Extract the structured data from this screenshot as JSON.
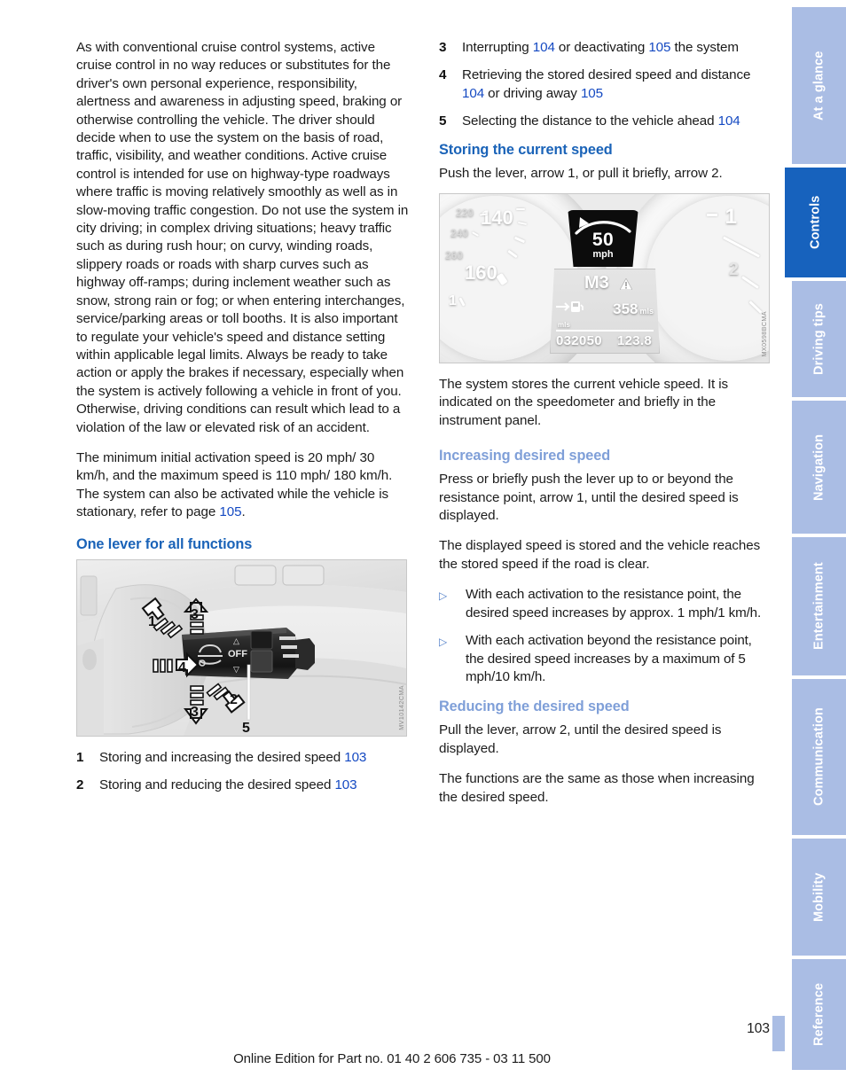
{
  "document": {
    "page_number": "103",
    "footer": "Online Edition for Part no. 01 40 2 606 735 - 03 11 500"
  },
  "left_column": {
    "paragraph_1": "As with conventional cruise control systems, active cruise control in no way reduces or substitutes for the driver's own personal experience, responsibility, alertness and awareness in adjusting speed, braking or otherwise controlling the vehicle. The driver should decide when to use the system on the basis of road, traffic, visibility, and weather conditions. Active cruise control is intended for use on highway-type roadways where traffic is moving relatively smoothly as well as in slow-moving traffic congestion. Do not use the system in city driving; in complex driving situations; heavy traffic such as during rush hour; on curvy, winding roads, slippery roads or roads with sharp curves such as highway off-ramps; during inclement weather such as snow, strong rain or fog; or when entering interchanges, service/parking areas or toll booths. It is also important to regulate your vehicle's speed and distance setting within applicable legal limits. Always be ready to take action or apply the brakes if necessary, especially when the system is actively following a vehicle in front of you. Otherwise, driving conditions can result which lead to a violation of the law or elevated risk of an accident.",
    "paragraph_2_part_1": "The minimum initial activation speed is 20 mph/ 30 km/h, and the maximum speed is 110 mph/ 180 km/h. The system can also be activated while the vehicle is stationary, refer to page ",
    "paragraph_2_link": "105",
    "paragraph_2_part_2": ".",
    "heading": "One lever for all functions",
    "figure": {
      "code": "MV10142CMA",
      "callouts": [
        "1",
        "2",
        "3",
        "3",
        "4",
        "5"
      ],
      "switch_labels": {
        "up": "△",
        "off": "OFF",
        "down": "▽"
      }
    },
    "list": [
      {
        "num": "1",
        "text_before": "Storing and increasing the desired speed ",
        "link": "103",
        "text_after": ""
      },
      {
        "num": "2",
        "text_before": "Storing and reducing the desired speed ",
        "link": "103",
        "text_after": ""
      }
    ]
  },
  "right_column": {
    "list": [
      {
        "num": "3",
        "t1": "Interrupting ",
        "l1": "104",
        "t2": " or deactivating ",
        "l2": "105",
        "t3": " the system"
      },
      {
        "num": "4",
        "t1": "Retrieving the stored desired speed and distance ",
        "l1": "104",
        "t2": " or driving away ",
        "l2": "105",
        "t3": ""
      },
      {
        "num": "5",
        "t1": "Selecting the distance to the vehicle ahead ",
        "l1": "104",
        "t2": "",
        "l2": "",
        "t3": ""
      }
    ],
    "heading_storing": "Storing the current speed",
    "paragraph_storing": "Push the lever, arrow 1, or pull it briefly, arrow 2.",
    "figure": {
      "code": "MX0598BCMA",
      "speed_value": "50",
      "speed_unit": "mph",
      "gear": "M3",
      "range_value": "358",
      "range_unit": "mls",
      "odometer": "032050",
      "trip": "123.8",
      "trip_unit_label": "mls",
      "dial_numbers_left": [
        "220",
        "240",
        "260",
        "140",
        "160",
        "1"
      ],
      "dial_numbers_right": [
        "1",
        "2"
      ]
    },
    "paragraph_after_figure": "The system stores the current vehicle speed. It is indicated on the speedometer and briefly in the instrument panel.",
    "heading_increasing": "Increasing desired speed",
    "paragraph_increasing_1": "Press or briefly push the lever up to or beyond the resistance point, arrow 1, until the desired speed is displayed.",
    "paragraph_increasing_2": "The displayed speed is stored and the vehicle reaches the stored speed if the road is clear.",
    "bullets": [
      "With each activation to the resistance point, the desired speed increases by approx. 1 mph/1 km/h.",
      "With each activation beyond the resistance point, the desired speed increases by a maximum of 5 mph/10 km/h."
    ],
    "heading_reducing": "Reducing the desired speed",
    "paragraph_reducing_1": "Pull the lever, arrow 2, until the desired speed is displayed.",
    "paragraph_reducing_2": "The functions are the same as those when increasing the desired speed."
  },
  "sidebar": {
    "tabs": [
      {
        "label": "At a glance",
        "active": false
      },
      {
        "label": "Controls",
        "active": true
      },
      {
        "label": "Driving tips",
        "active": false
      },
      {
        "label": "Navigation",
        "active": false
      },
      {
        "label": "Entertainment",
        "active": false
      },
      {
        "label": "Communication",
        "active": false
      },
      {
        "label": "Mobility",
        "active": false
      },
      {
        "label": "Reference",
        "active": false
      }
    ],
    "colors": {
      "inactive": "#aabde4",
      "active": "#1762bd",
      "text": "#ffffff"
    }
  },
  "colors": {
    "heading_primary": "#1a63b8",
    "heading_secondary": "#7f9fd8",
    "link": "#1449c2",
    "body_text": "#1c1c1c"
  }
}
